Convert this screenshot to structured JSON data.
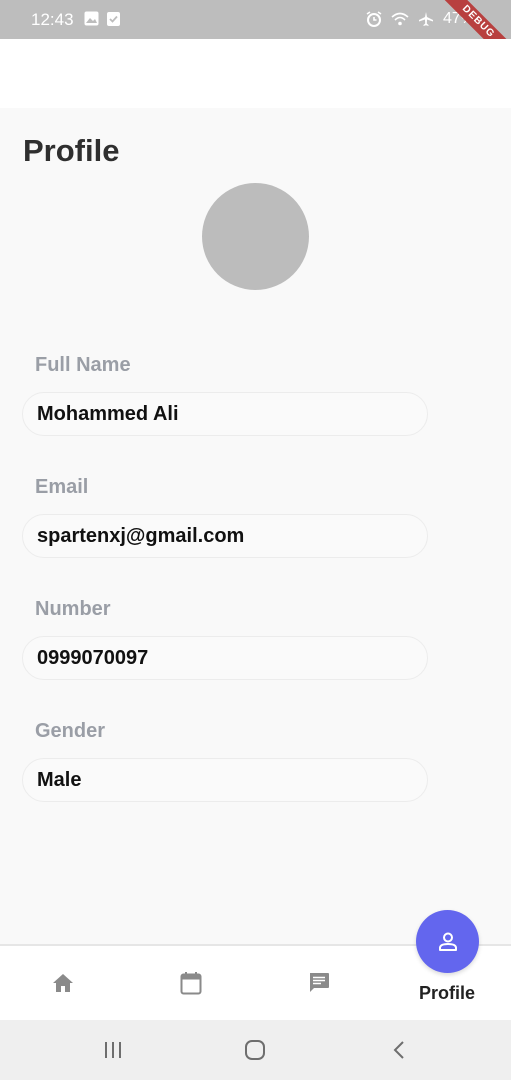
{
  "status_bar": {
    "time": "12:43",
    "battery": "47%",
    "debug_label": "DEBUG"
  },
  "page": {
    "title": "Profile"
  },
  "fields": {
    "full_name": {
      "label": "Full Name",
      "value": "Mohammed Ali"
    },
    "email": {
      "label": "Email",
      "value": "spartenxj@gmail.com"
    },
    "number": {
      "label": "Number",
      "value": "0999070097"
    },
    "gender": {
      "label": "Gender",
      "value": "Male"
    }
  },
  "bottom_nav": {
    "items": [
      {
        "icon": "home-icon"
      },
      {
        "icon": "calendar-icon"
      },
      {
        "icon": "chat-icon"
      },
      {
        "icon": "person-icon",
        "label": "Profile",
        "active": true
      }
    ]
  },
  "colors": {
    "accent": "#6366ee",
    "label": "#9a9ea6",
    "avatar": "#bcbcbc"
  }
}
